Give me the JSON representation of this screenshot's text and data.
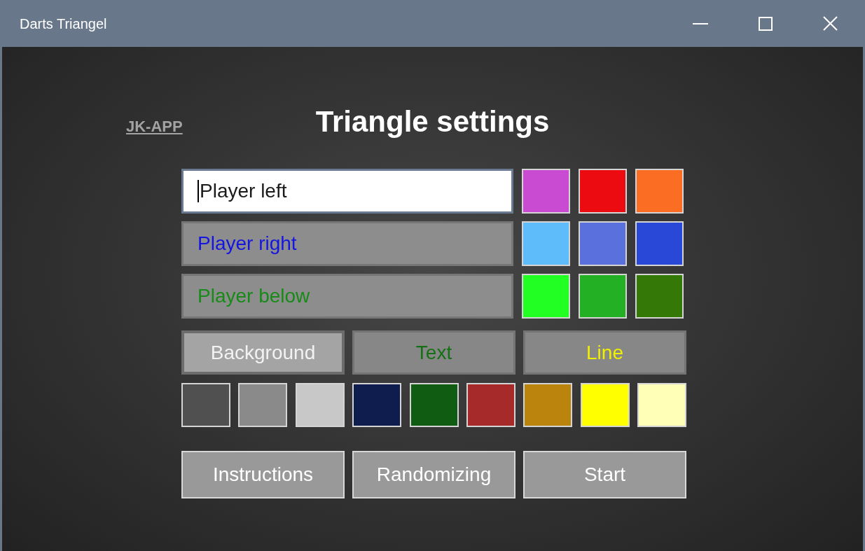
{
  "window": {
    "title": "Darts Triangel"
  },
  "header": {
    "link": "JK-APP",
    "title": "Triangle settings"
  },
  "players": [
    {
      "value": "Player left",
      "focused": true,
      "color": "#1a1a1a",
      "swatches": [
        {
          "color": "#c94bd2"
        },
        {
          "color": "#ec0b10"
        },
        {
          "color": "#fb6d23"
        }
      ]
    },
    {
      "value": "Player right",
      "focused": false,
      "color": "#1515e0",
      "swatches": [
        {
          "color": "#5fbcfa"
        },
        {
          "color": "#5a70dc"
        },
        {
          "color": "#2a48d8"
        }
      ]
    },
    {
      "value": "Player below",
      "focused": false,
      "color": "#188a18",
      "swatches": [
        {
          "color": "#22ff22"
        },
        {
          "color": "#24b024"
        },
        {
          "color": "#347808"
        }
      ]
    }
  ],
  "color_targets": [
    {
      "label": "Background",
      "selected": true,
      "color": "#f2f2f2"
    },
    {
      "label": "Text",
      "selected": false,
      "color": "#167016"
    },
    {
      "label": "Line",
      "selected": false,
      "color": "#f0f000"
    }
  ],
  "palette": [
    {
      "color": "#505050"
    },
    {
      "color": "#8a8a8a"
    },
    {
      "color": "#c8c8c8"
    },
    {
      "color": "#0f1c4e"
    },
    {
      "color": "#0f5c12"
    },
    {
      "color": "#a62a2a"
    },
    {
      "color": "#bb840c"
    },
    {
      "color": "#ffff00"
    },
    {
      "color": "#ffffb8"
    }
  ],
  "buttons": [
    "Instructions",
    "Randomizing",
    "Start"
  ]
}
